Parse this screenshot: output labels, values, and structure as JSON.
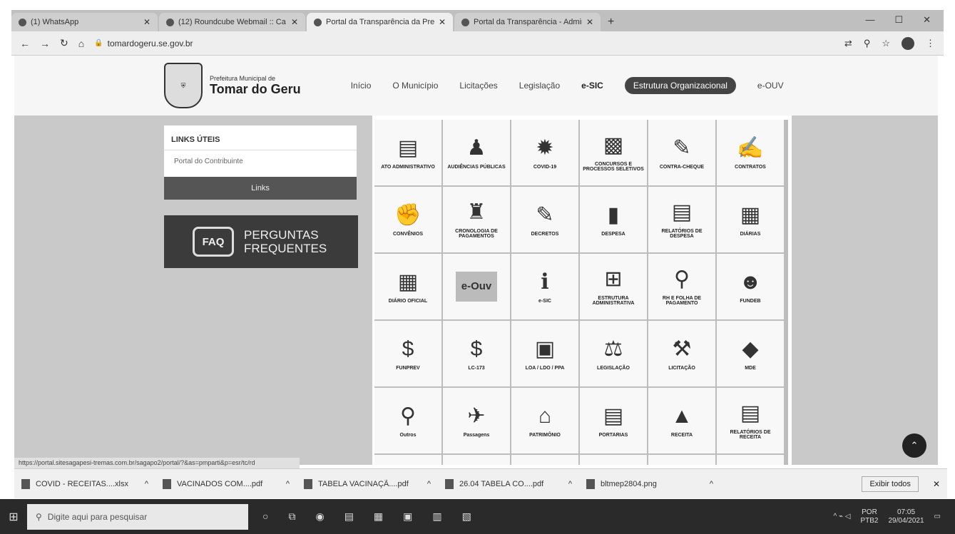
{
  "browser": {
    "tabs": [
      {
        "title": "(1) WhatsApp"
      },
      {
        "title": "(12) Roundcube Webmail :: Ca"
      },
      {
        "title": "Portal da Transparência da Prefei"
      },
      {
        "title": "Portal da Transparência - Admin"
      }
    ],
    "new_tab": "+",
    "url": "tomardogeru.se.gov.br"
  },
  "site": {
    "logo_small": "Prefeitura Municipal de",
    "logo_big": "Tomar do Geru",
    "nav": [
      "Início",
      "O Município",
      "Licitações",
      "Legislação",
      "e-SIC",
      "Estrutura Organizacional",
      "e-OUV"
    ]
  },
  "links_box": {
    "title": "LINKS ÚTEIS",
    "item": "Portal do Contribuinte",
    "button": "Links"
  },
  "faq": {
    "bubble": "FAQ",
    "line1": "PERGUNTAS",
    "line2": "FREQUENTES"
  },
  "grid": [
    {
      "label": "ATO ADMINISTRATIVO",
      "icon": "document-icon"
    },
    {
      "label": "AUDIÊNCIAS PÚBLICAS",
      "icon": "audience-icon"
    },
    {
      "label": "COVID-19",
      "icon": "virus-icon"
    },
    {
      "label": "CONCURSOS E PROCESSOS SELETIVOS",
      "icon": "reader-icon"
    },
    {
      "label": "CONTRA-CHEQUE",
      "icon": "check-icon"
    },
    {
      "label": "CONTRATOS",
      "icon": "contract-icon"
    },
    {
      "label": "CONVÊNIOS",
      "icon": "handshake-icon"
    },
    {
      "label": "CRONOLOGIA DE PAGAMENTOS",
      "icon": "people-icon"
    },
    {
      "label": "DECRETOS",
      "icon": "decree-icon"
    },
    {
      "label": "DESPESA",
      "icon": "chart-icon"
    },
    {
      "label": "RELATÓRIOS DE DESPESA",
      "icon": "report-icon"
    },
    {
      "label": "DIÁRIAS",
      "icon": "daily-icon"
    },
    {
      "label": "DIÁRIO OFICIAL",
      "icon": "calendar-icon"
    },
    {
      "label": "",
      "icon": "eouv-icon",
      "text_icon": "e-Ouv"
    },
    {
      "label": "e-SIC",
      "icon": "info-icon"
    },
    {
      "label": "ESTRUTURA ADMINISTRATIVA",
      "icon": "org-chart-icon"
    },
    {
      "label": "RH E FOLHA DE PAGAMENTO",
      "icon": "person-search-icon"
    },
    {
      "label": "FUNDEB",
      "icon": "student-icon"
    },
    {
      "label": "FUNPREV",
      "icon": "money-icon"
    },
    {
      "label": "LC-173",
      "icon": "dollar-icon"
    },
    {
      "label": "LOA / LDO / PPA",
      "icon": "presentation-icon"
    },
    {
      "label": "LEGISLAÇÃO",
      "icon": "scales-icon"
    },
    {
      "label": "LICITAÇÃO",
      "icon": "gavel-icon"
    },
    {
      "label": "MDE",
      "icon": "graduation-icon"
    },
    {
      "label": "Outros",
      "icon": "magnifier-icon"
    },
    {
      "label": "Passagens",
      "icon": "ticket-icon"
    },
    {
      "label": "PATRIMÔNIO",
      "icon": "house-icon"
    },
    {
      "label": "PORTARIAS",
      "icon": "portaria-icon"
    },
    {
      "label": "RECEITA",
      "icon": "growth-icon"
    },
    {
      "label": "RELATÓRIOS DE RECEITA",
      "icon": "report2-icon"
    },
    {
      "label": "",
      "icon": "person-chart-icon"
    },
    {
      "label": "",
      "icon": "list-icon"
    },
    {
      "label": "",
      "icon": "coin-icon"
    },
    {
      "label": "",
      "icon": "file-icon"
    },
    {
      "label": "",
      "icon": "table-icon"
    },
    {
      "label": "",
      "icon": "stamp-icon"
    }
  ],
  "status_url": "https://portal.sitesagapesi-tremas.com.br/sagapo2/portal/?&as=pmparti&p=esr/tc/rd",
  "downloads": [
    {
      "name": "COVID - RECEITAS....xlsx"
    },
    {
      "name": "VACINADOS COM....pdf"
    },
    {
      "name": "TABELA VACINAÇÃ....pdf"
    },
    {
      "name": "26.04 TABELA CO....pdf"
    },
    {
      "name": "bltmep2804.png"
    }
  ],
  "downloads_show_all": "Exibir todos",
  "taskbar": {
    "search_placeholder": "Digite aqui para pesquisar",
    "lang": "POR",
    "lang2": "PTB2",
    "time": "07:05",
    "date": "29/04/2021"
  }
}
